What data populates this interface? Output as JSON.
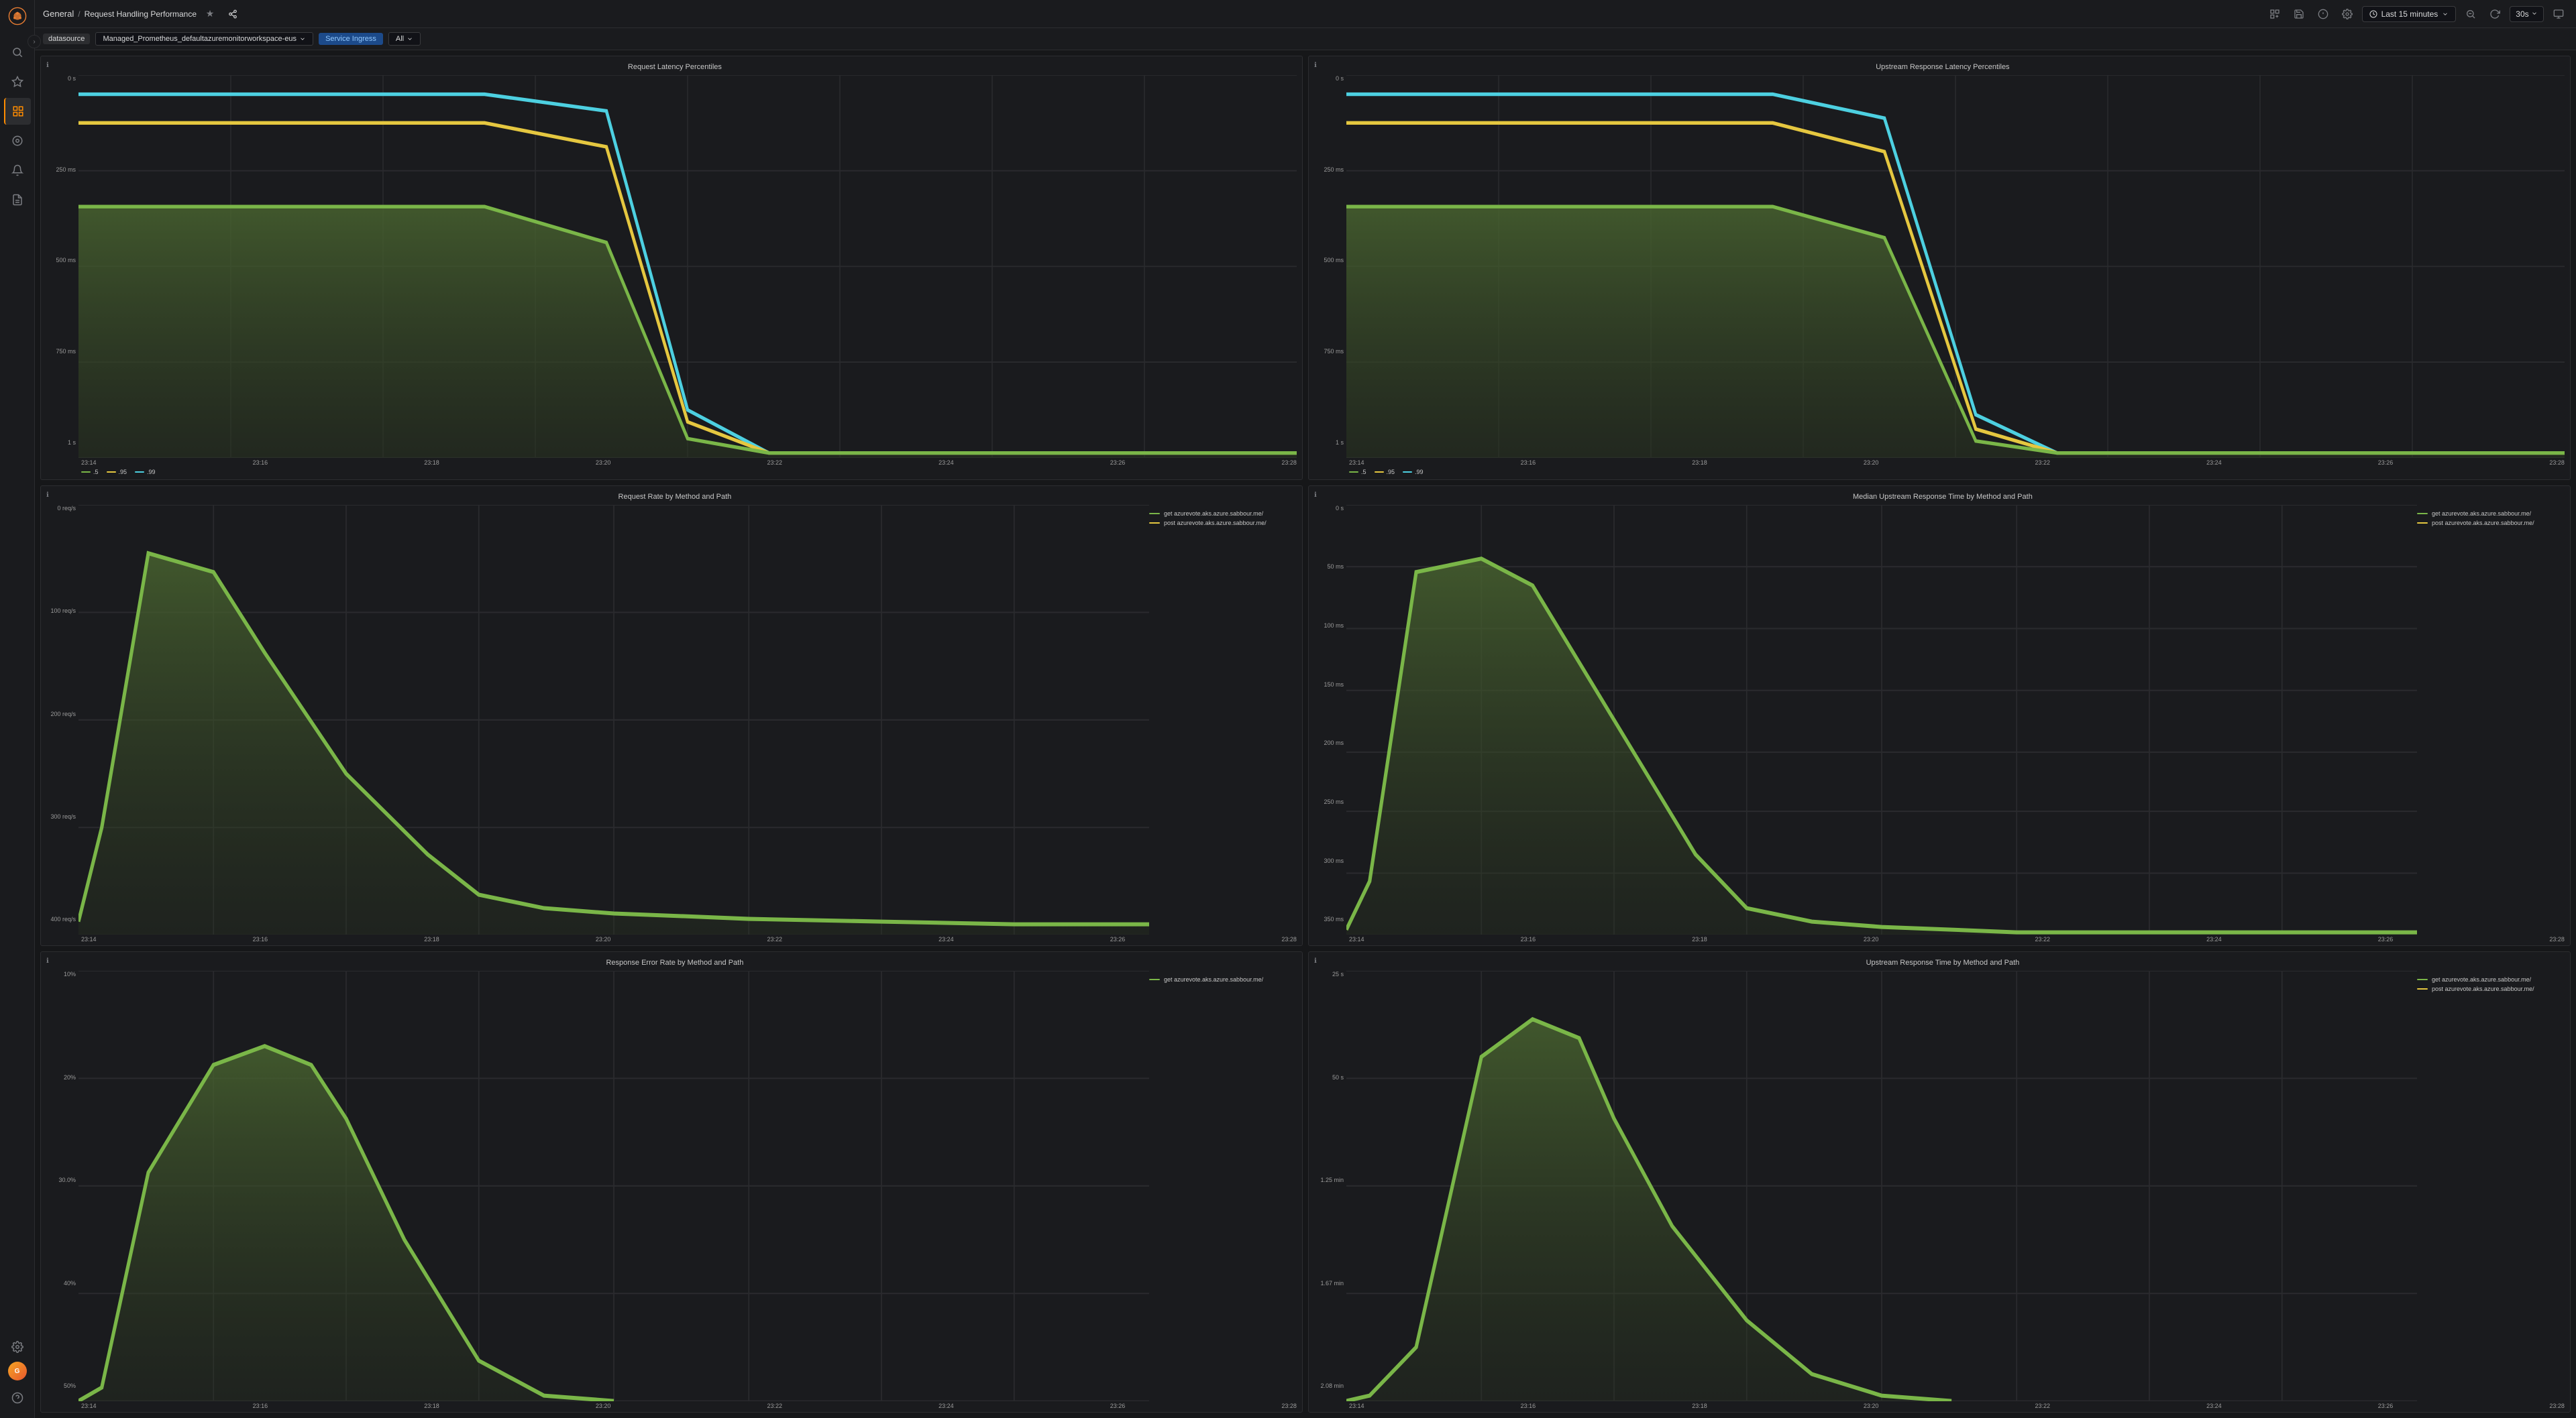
{
  "app": {
    "logo": "grafana",
    "breadcrumb": {
      "prefix": "General",
      "separator": "/",
      "title": "Request Handling Performance"
    }
  },
  "topbar": {
    "star_icon": "★",
    "share_icon": "⤢",
    "dashboard_icon": "⊞",
    "save_icon": "💾",
    "help_icon": "?",
    "settings_icon": "⚙",
    "time_icon": "⏱",
    "time_range": "Last 15 minutes",
    "zoom_out": "⊖",
    "refresh_icon": "↻",
    "refresh_interval": "30s",
    "tv_icon": "⬜"
  },
  "filterbar": {
    "datasource_label": "datasource",
    "datasource_value": "Managed_Prometheus_defaultazuremonitorworkspace-eus",
    "service_ingress_label": "Service Ingress",
    "all_label": "All",
    "all_chevron": "▾"
  },
  "panels": [
    {
      "id": "request-latency",
      "title": "Request Latency Percentiles",
      "y_labels": [
        "1 s",
        "750 ms",
        "500 ms",
        "250 ms",
        "0 s"
      ],
      "x_labels": [
        "23:14",
        "23:16",
        "23:18",
        "23:20",
        "23:22",
        "23:24",
        "23:26",
        "23:28"
      ],
      "legend": [
        {
          "color": "#7ab648",
          "label": ".5"
        },
        {
          "color": "#e5c740",
          "label": ".95"
        },
        {
          "color": "#4dd0e1",
          "label": ".99"
        }
      ],
      "has_right_legend": false
    },
    {
      "id": "upstream-response-latency",
      "title": "Upstream Response Latency Percentiles",
      "y_labels": [
        "1 s",
        "750 ms",
        "500 ms",
        "250 ms",
        "0 s"
      ],
      "x_labels": [
        "23:14",
        "23:16",
        "23:18",
        "23:20",
        "23:22",
        "23:24",
        "23:26",
        "23:28"
      ],
      "legend": [
        {
          "color": "#7ab648",
          "label": ".5"
        },
        {
          "color": "#e5c740",
          "label": ".95"
        },
        {
          "color": "#4dd0e1",
          "label": ".99"
        }
      ],
      "has_right_legend": false
    },
    {
      "id": "request-rate",
      "title": "Request Rate by Method and Path",
      "y_labels": [
        "400 req/s",
        "300 req/s",
        "200 req/s",
        "100 req/s",
        "0 req/s"
      ],
      "x_labels": [
        "23:14",
        "23:16",
        "23:18",
        "23:20",
        "23:22",
        "23:24",
        "23:26",
        "23:28"
      ],
      "legend_right": [
        {
          "color": "#7ab648",
          "label": "get azurevote.aks.azure.sabbour.me/"
        },
        {
          "color": "#e5c740",
          "label": "post azurevote.aks.azure.sabbour.me/"
        }
      ],
      "has_right_legend": true
    },
    {
      "id": "median-upstream-response",
      "title": "Median Upstream Response Time by Method and Path",
      "y_labels": [
        "350 ms",
        "300 ms",
        "250 ms",
        "200 ms",
        "150 ms",
        "100 ms",
        "50 ms",
        "0 s"
      ],
      "x_labels": [
        "23:14",
        "23:16",
        "23:18",
        "23:20",
        "23:22",
        "23:24",
        "23:26",
        "23:28"
      ],
      "legend_right": [
        {
          "color": "#7ab648",
          "label": "get azurevote.aks.azure.sabbour.me/"
        },
        {
          "color": "#e5c740",
          "label": "post azurevote.aks.azure.sabbour.me/"
        }
      ],
      "has_right_legend": true
    },
    {
      "id": "response-error-rate",
      "title": "Response Error Rate by Method and Path",
      "y_labels": [
        "50%",
        "40%",
        "30.0%",
        "20%",
        "10%"
      ],
      "x_labels": [
        "23:14",
        "23:16",
        "23:18",
        "23:20",
        "23:22",
        "23:24",
        "23:26",
        "23:28"
      ],
      "legend_right": [
        {
          "color": "#7ab648",
          "label": "get azurevote.aks.azure.sabbour.me/"
        }
      ],
      "has_right_legend": true
    },
    {
      "id": "upstream-response-time",
      "title": "Upstream Response Time by Method and Path",
      "y_labels": [
        "2.08 min",
        "1.67 min",
        "1.25 min",
        "50 s",
        "25 s"
      ],
      "x_labels": [
        "23:14",
        "23:16",
        "23:18",
        "23:20",
        "23:22",
        "23:24",
        "23:26",
        "23:28"
      ],
      "legend_right": [
        {
          "color": "#7ab648",
          "label": "get azurevote.aks.azure.sabbour.me/"
        },
        {
          "color": "#e5c740",
          "label": "post azurevote.aks.azure.sabbour.me/"
        }
      ],
      "has_right_legend": true
    }
  ],
  "sidebar": {
    "items": [
      {
        "id": "search",
        "icon": "🔍"
      },
      {
        "id": "starred",
        "icon": "★"
      },
      {
        "id": "dashboards",
        "icon": "⊞"
      },
      {
        "id": "explore",
        "icon": "◎"
      },
      {
        "id": "alerting",
        "icon": "🔔"
      },
      {
        "id": "reports",
        "icon": "📄"
      }
    ],
    "bottom": [
      {
        "id": "settings",
        "icon": "⚙"
      },
      {
        "id": "avatar",
        "icon": "U"
      },
      {
        "id": "help",
        "icon": "?"
      }
    ]
  },
  "colors": {
    "green_line": "#7ab648",
    "yellow_line": "#e5c740",
    "cyan_line": "#4dd0e1",
    "fill_green": "#4a6630",
    "fill_dark": "#2a3520",
    "grid": "#2a2b2e",
    "axis": "#3a3b3e"
  }
}
